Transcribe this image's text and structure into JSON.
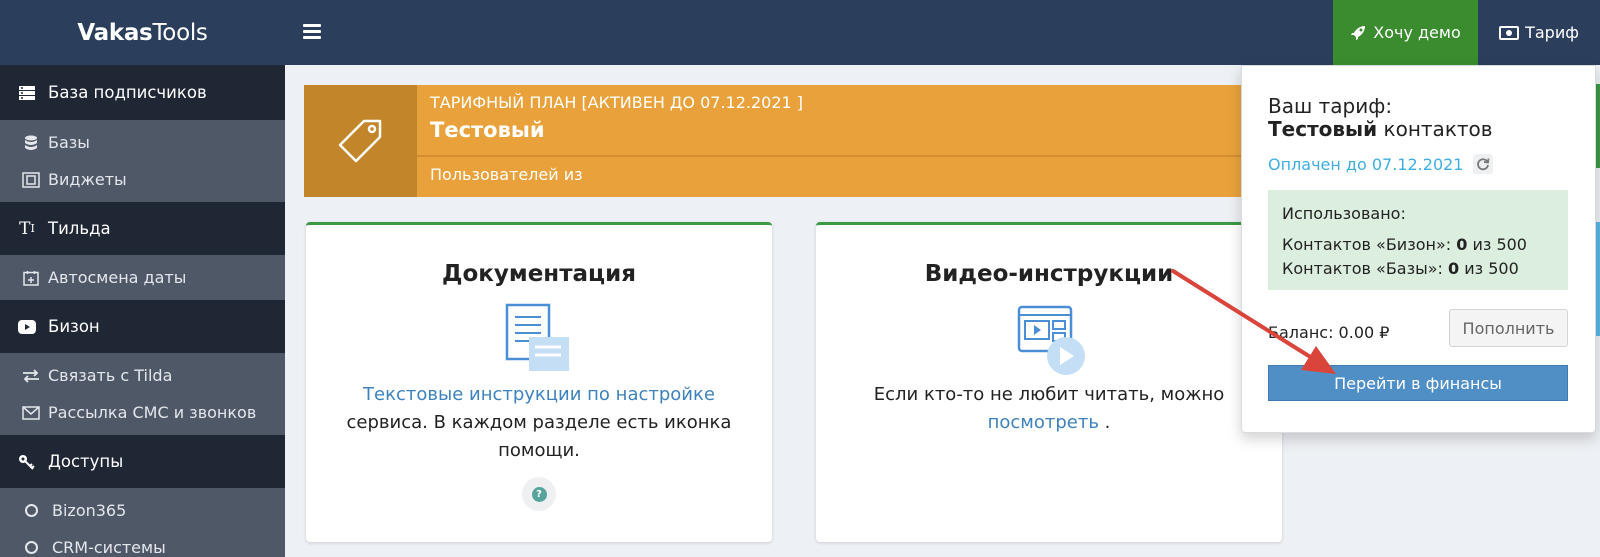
{
  "brand": {
    "bold": "Vakas",
    "rest": "Tools"
  },
  "header": {
    "menu_icon": "hamburger-icon",
    "demo_label": "Хочу демо",
    "tarif_label": "Тариф"
  },
  "sidebar": {
    "items": [
      {
        "type": "head",
        "icon": "database-list-icon",
        "label": "База подписчиков"
      },
      {
        "type": "sub",
        "icon": "database-icon",
        "label": "Базы"
      },
      {
        "type": "sub",
        "icon": "widget-icon",
        "label": "Виджеты"
      },
      {
        "type": "head",
        "icon": "text-tilda-icon",
        "label": "Тильда"
      },
      {
        "type": "sub",
        "icon": "calendar-icon",
        "label": "Автосмена даты"
      },
      {
        "type": "head",
        "icon": "youtube-icon",
        "label": "Бизон"
      },
      {
        "type": "sub",
        "icon": "exchange-icon",
        "label": "Связать с Tilda"
      },
      {
        "type": "sub",
        "icon": "envelope-icon",
        "label": "Рассылка СМС и звонков"
      },
      {
        "type": "head",
        "icon": "key-icon",
        "label": "Доступы"
      },
      {
        "type": "sub",
        "icon": "circle-icon",
        "label": "Bizon365"
      },
      {
        "type": "sub",
        "icon": "circle-icon",
        "label": "CRM-системы"
      }
    ]
  },
  "plan": {
    "heading": "ТАРИФНЫЙ ПЛАН [АКТИВЕН ДО 07.12.2021 ]",
    "name": "Тестовый",
    "users": "Пользователей из"
  },
  "cards": {
    "docs": {
      "title": "Документация",
      "link": "Текстовые инструкции по настройке",
      "text": "сервиса. В каждом разделе есть иконка помощи."
    },
    "video": {
      "title": "Видео-инструкции",
      "text": "Если кто-то не любит читать, можно",
      "link": "посмотреть",
      "after": " ."
    }
  },
  "dropdown": {
    "your_plan": "Ваш тариф:",
    "plan_bold": "Тестовый",
    "plan_rest": " контактов",
    "paid_until": "Оплачен до 07.12.2021",
    "used_label": "Использовано:",
    "bizon_label": "Контактов «Бизон»: ",
    "bizon_used": "0",
    "bizon_total": " из 500",
    "bases_label": "Контактов «Базы»: ",
    "bases_used": "0",
    "bases_total": " из 500",
    "balance": "Баланс: 0.00 ₽",
    "topup_label": "Пополнить",
    "finance_label": "Перейти в финансы"
  },
  "colors": {
    "header": "#2b3f5c",
    "demo": "#3a8c2f",
    "plan": "#e9a23b",
    "accent_link": "#3d82bc",
    "arrow": "#d9453a"
  }
}
